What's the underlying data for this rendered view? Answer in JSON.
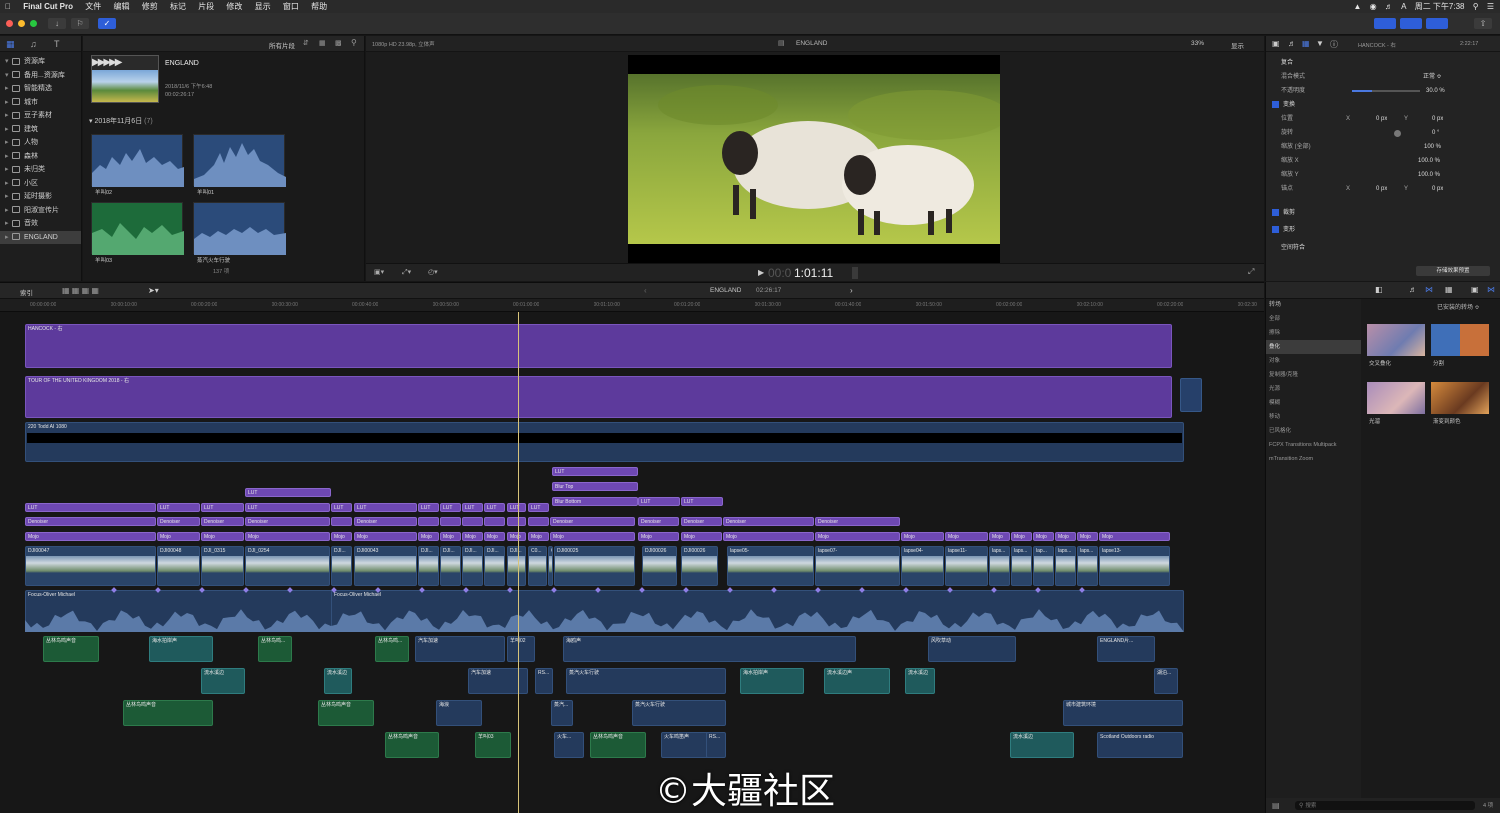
{
  "menubar": {
    "app": "Final Cut Pro",
    "items": [
      "文件",
      "编辑",
      "修剪",
      "标记",
      "片段",
      "修改",
      "显示",
      "窗口",
      "帮助"
    ],
    "clock": "周二 下午7:38"
  },
  "browser": {
    "library_items": [
      {
        "label": "资源库",
        "expanded": true,
        "selected": false
      },
      {
        "label": "备用...资源库",
        "expanded": true,
        "selected": false
      },
      {
        "label": "智能精选",
        "expanded": false,
        "selected": false
      },
      {
        "label": "城市",
        "expanded": false,
        "selected": false
      },
      {
        "label": "豆子素材",
        "expanded": false,
        "selected": false
      },
      {
        "label": "建筑",
        "expanded": false,
        "selected": false
      },
      {
        "label": "人物",
        "expanded": false,
        "selected": false
      },
      {
        "label": "森林",
        "expanded": false,
        "selected": false
      },
      {
        "label": "未归类",
        "expanded": false,
        "selected": false
      },
      {
        "label": "小区",
        "expanded": false,
        "selected": false
      },
      {
        "label": "延时摄影",
        "expanded": false,
        "selected": false
      },
      {
        "label": "阳淑宣传片",
        "expanded": false,
        "selected": false
      },
      {
        "label": "音效",
        "expanded": false,
        "selected": false
      },
      {
        "label": "ENGLAND",
        "expanded": false,
        "selected": true
      }
    ],
    "filter": "所有片段",
    "project": {
      "title": "ENGLAND",
      "date": "2018/11/6 下午6:48",
      "duration": "00:02:26:17"
    },
    "group_header": "2018年11月6日",
    "group_count": "(7)",
    "clips": [
      "羊叫02",
      "羊叫01",
      "羊叫03",
      "蒸汽火车行驶"
    ],
    "item_count": "137 项"
  },
  "viewer": {
    "format": "1080p HD 23.98p, 立体声",
    "title": "ENGLAND",
    "zoom": "33%",
    "view_menu": "显示",
    "timecode_dim": "00:0",
    "timecode": "1:01:11"
  },
  "inspector": {
    "clip_name": "HANCOCK - 右",
    "clip_duration": "2:22:17",
    "sections": {
      "compositing": "复合",
      "blend_mode_label": "混合模式",
      "blend_mode_value": "正常 ≎",
      "opacity_label": "不透明度",
      "opacity_value": "30.0 %",
      "opacity": 0.3,
      "transform": "变换",
      "position": "位置",
      "rotation": "旋转",
      "scale_all": "缩放 (全部)",
      "scale_x": "缩放 X",
      "scale_y": "缩放 Y",
      "anchor": "锚点",
      "crop": "裁剪",
      "distort": "变形",
      "spatial": "空间符合",
      "x": "X",
      "y": "Y",
      "px0": "0 px",
      "deg0": "0 °",
      "pct100": "100 %",
      "pct1000": "100.0 %",
      "save_preset": "存储效果预置"
    }
  },
  "timeline": {
    "index_label": "索引",
    "project_name": "ENGLAND",
    "project_duration": "02:26:17",
    "ruler": [
      "00:00:00:00",
      "00:00:10:00",
      "00:00:20:00",
      "00:00:30:00",
      "00:00:40:00",
      "00:00:50:00",
      "00:01:00:00",
      "00:01:10:00",
      "00:01:20:00",
      "00:01:30:00",
      "00:01:40:00",
      "00:01:50:00",
      "00:02:00:00",
      "00:02:10:00",
      "00:02:20:00",
      "00:02:30"
    ],
    "titles": {
      "hancock": "HANCOCK - 右",
      "tour": "TOUR OF THE UNITED KINGDOM 2018 - 右",
      "lut_layer": "220 Todd AI 1080"
    },
    "effects": {
      "lut": "LUT",
      "den": "Denoiser",
      "mojo": "Mojo",
      "blur_top": "Blur Top",
      "blur_bottom": "Blur Bottom"
    },
    "video_clips": [
      "DJI00047",
      "DJI00048",
      "DJI_0315",
      "DJI_0254",
      "DJI...",
      "DJI00043",
      "DJI...",
      "DJI...",
      "DJI...",
      "DJI...",
      "DJI...",
      "C0...",
      "C0...",
      "DJI00025",
      "DJI00026",
      "DJI00026",
      "lapse05-",
      "lapse07-",
      "lapse04-",
      "lapse11-",
      "laps...",
      "laps...",
      "lap...",
      "laps...",
      "laps...",
      "lapse13-"
    ],
    "music": "Focus-Oliver Michael",
    "audio_clips": [
      "丛林鸟鸣声音",
      "海水拍岸声",
      "丛林鸟鸣...",
      "丛林鸟鸣...",
      "汽车加速",
      "羊叫02",
      "海鸥声",
      "风吹草动",
      "ENGLAND片...",
      "流水溪边",
      "流水溪边",
      "汽车加速",
      "RS...",
      "蒸汽火车行驶",
      "海水拍岸声",
      "流水溪边声",
      "流水溪边",
      "湖泊...",
      "丛林鸟鸣声音",
      "丛林鸟鸣声音",
      "海浪",
      "蒸汽...",
      "蒸汽火车行驶",
      "城市建筑环境",
      "丛林鸟鸣声音",
      "羊叫03",
      "火车...",
      "丛林鸟鸣声音",
      "火车鸣笛声",
      "流水溪边",
      "Scotland Outdoors radio",
      "RS..."
    ]
  },
  "transitions": {
    "header": "转场",
    "filter": "已安装的转场 ≎",
    "categories": [
      "全部",
      "擦除",
      "叠化",
      "对象",
      "复制器/克隆",
      "光源",
      "模糊",
      "移动",
      "已风格化",
      "FCPX Transitions Multipack",
      "mTransition Zoom"
    ],
    "selected_category": "叠化",
    "items": [
      "交叉叠化",
      "分割",
      "光溜",
      "渐变到颜色"
    ],
    "search_placeholder": "搜索",
    "count": "4 项"
  },
  "watermark": "©大疆社区",
  "colors": {
    "accent": "#2e5ed8",
    "purple": "#5d3a9c",
    "blue_clip": "#26406a",
    "green_audio": "#1c5a36",
    "teal_audio": "#1f5a5c",
    "playhead": "#d8c47a"
  }
}
